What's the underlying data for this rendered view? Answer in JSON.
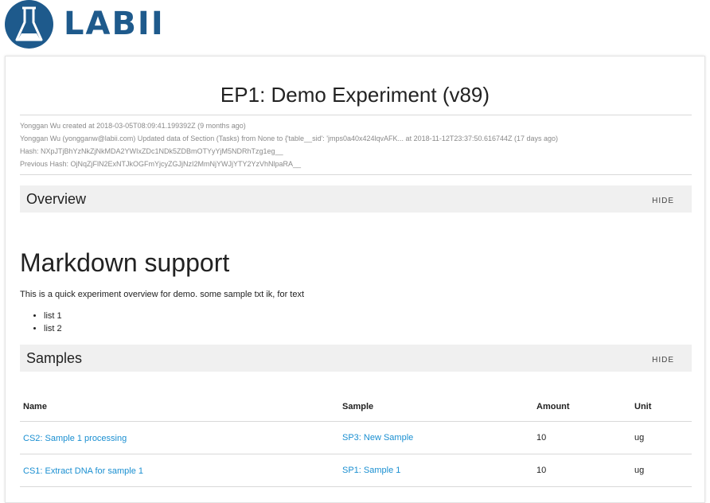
{
  "brand": {
    "logo_text": "LABII",
    "logo_icon": "flask-icon",
    "color": "#1e5a8c"
  },
  "experiment": {
    "title": "EP1: Demo Experiment (v89)",
    "meta": [
      "Yonggan Wu created at 2018-03-05T08:09:41.199392Z (9 months ago)",
      "Yonggan Wu (yongganw@labii.com) Updated data of Section (Tasks) from None to {'table__sid': 'jmps0a40x424lqvAFK... at 2018-11-12T23:37:50.616744Z (17 days ago)",
      "Hash: NXpJTjBhYzNkZjNkMDA2YWIxZDc1NDk5ZDBmOTYyYjM5NDRhTzg1eg__",
      "Previous Hash: OjNqZjFlN2ExNTJkOGFmYjcyZGJjNzI2MmNjYWJjYTY2YzVhNlpaRA__"
    ]
  },
  "overview": {
    "section_title": "Overview",
    "hide_label": "HIDE",
    "heading": "Markdown support",
    "paragraph": "This is a quick experiment overview for demo. some sample txt ik, for text",
    "list": [
      "list 1",
      "list 2"
    ]
  },
  "samples": {
    "section_title": "Samples",
    "hide_label": "HIDE",
    "columns": [
      "Name",
      "Sample",
      "Amount",
      "Unit"
    ],
    "rows": [
      {
        "name": "CS2: Sample 1 processing",
        "sample": "SP3: New Sample",
        "amount": "10",
        "unit": "ug"
      },
      {
        "name": "CS1: Extract DNA for sample 1",
        "sample": "SP1: Sample 1",
        "amount": "10",
        "unit": "ug"
      }
    ],
    "link_color": "#1a8fd1"
  }
}
